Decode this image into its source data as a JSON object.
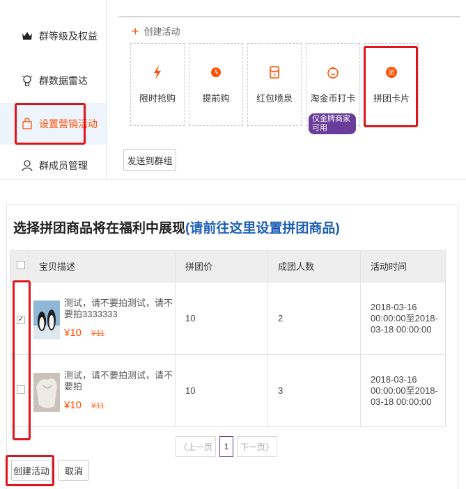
{
  "sidebar": {
    "items": [
      {
        "label": "群等级及权益",
        "icon": "crown-icon"
      },
      {
        "label": "群数据雷达",
        "icon": "bulb-icon"
      },
      {
        "label": "设置营销活动",
        "icon": "bag-icon"
      },
      {
        "label": "群成员管理",
        "icon": "person-icon"
      }
    ]
  },
  "create": {
    "heading": "创建活动",
    "cards": [
      {
        "label": "限时抢购",
        "icon": "lightning-icon"
      },
      {
        "label": "提前购",
        "icon": "clock-icon"
      },
      {
        "label": "红包喷泉",
        "icon": "red-envelope-icon"
      },
      {
        "label": "淘金币打卡",
        "icon": "coin-icon",
        "badge": "仅金牌商家可用"
      },
      {
        "label": "拼团卡片",
        "icon": "group-card-icon"
      }
    ],
    "send_button": "发送到群组"
  },
  "selection": {
    "title": "选择拼团商品将在福利中展现",
    "title_link": "(请前往这里设置拼团商品)",
    "columns": [
      "宝贝描述",
      "拼团价",
      "成团人数",
      "活动时间"
    ],
    "rows": [
      {
        "checked": true,
        "description": "测试，请不要拍测试，请不要拍3333333",
        "price_now": "¥10",
        "price_was": "¥11",
        "group_price": "10",
        "group_size": "2",
        "time": "2018-03-16 00:00:00至2018-03-18 00:00:00"
      },
      {
        "checked": false,
        "description": "测试，请不要拍测试，请不要拍",
        "price_now": "¥10",
        "price_was": "¥11",
        "group_price": "10",
        "group_size": "3",
        "time": "2018-03-16 00:00:00至2018-03-18 00:00:00"
      }
    ],
    "pagination": {
      "prev": "〈上一页",
      "current": "1",
      "next": "下一页〉"
    },
    "create_button": "创建活动",
    "cancel_button": "取消"
  },
  "colors": {
    "accent": "#ff5000",
    "highlight_box": "#e0121b",
    "link": "#1d5fb6",
    "badge": "#6a3d9a"
  }
}
